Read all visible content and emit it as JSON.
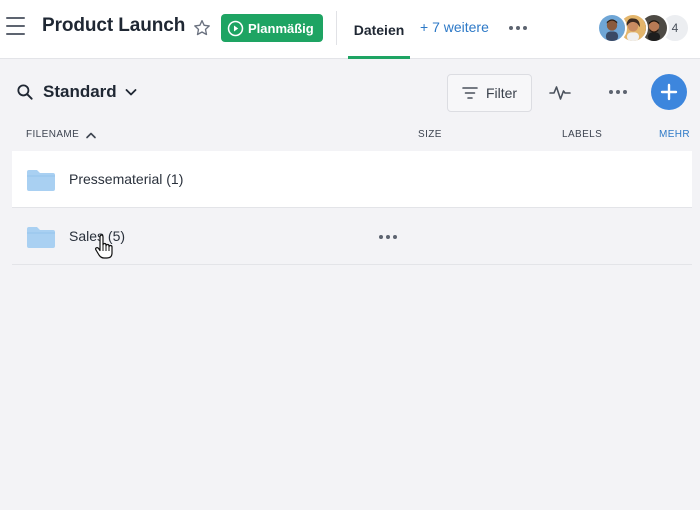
{
  "header": {
    "title": "Product Launch",
    "status_label": "Planmäßig",
    "active_tab": "Dateien",
    "more_tabs": "+ 7 weitere",
    "avatar_more_count": "4",
    "icons": [
      "menu-icon",
      "star-icon",
      "play-circle-icon",
      "more-horizontal-icon"
    ]
  },
  "toolbar": {
    "view_name": "Standard",
    "filter_label": "Filter",
    "icons": [
      "search-icon",
      "chevron-down-icon",
      "filter-icon",
      "activity-icon",
      "more-horizontal-icon",
      "plus-icon"
    ]
  },
  "table": {
    "columns": {
      "filename": "FILENAME",
      "size": "SIZE",
      "labels": "LABELS",
      "more": "MEHR"
    },
    "rows": [
      {
        "name": "Pressematerial (1)",
        "icon": "folder-icon"
      },
      {
        "name": "Sales (5)",
        "icon": "folder-icon"
      }
    ]
  },
  "colors": {
    "accent_green": "#1ea463",
    "accent_blue": "#3d86dd",
    "link_blue": "#2d79c7",
    "folder_blue": "#a9d0f2",
    "background": "#f3f3f6"
  }
}
